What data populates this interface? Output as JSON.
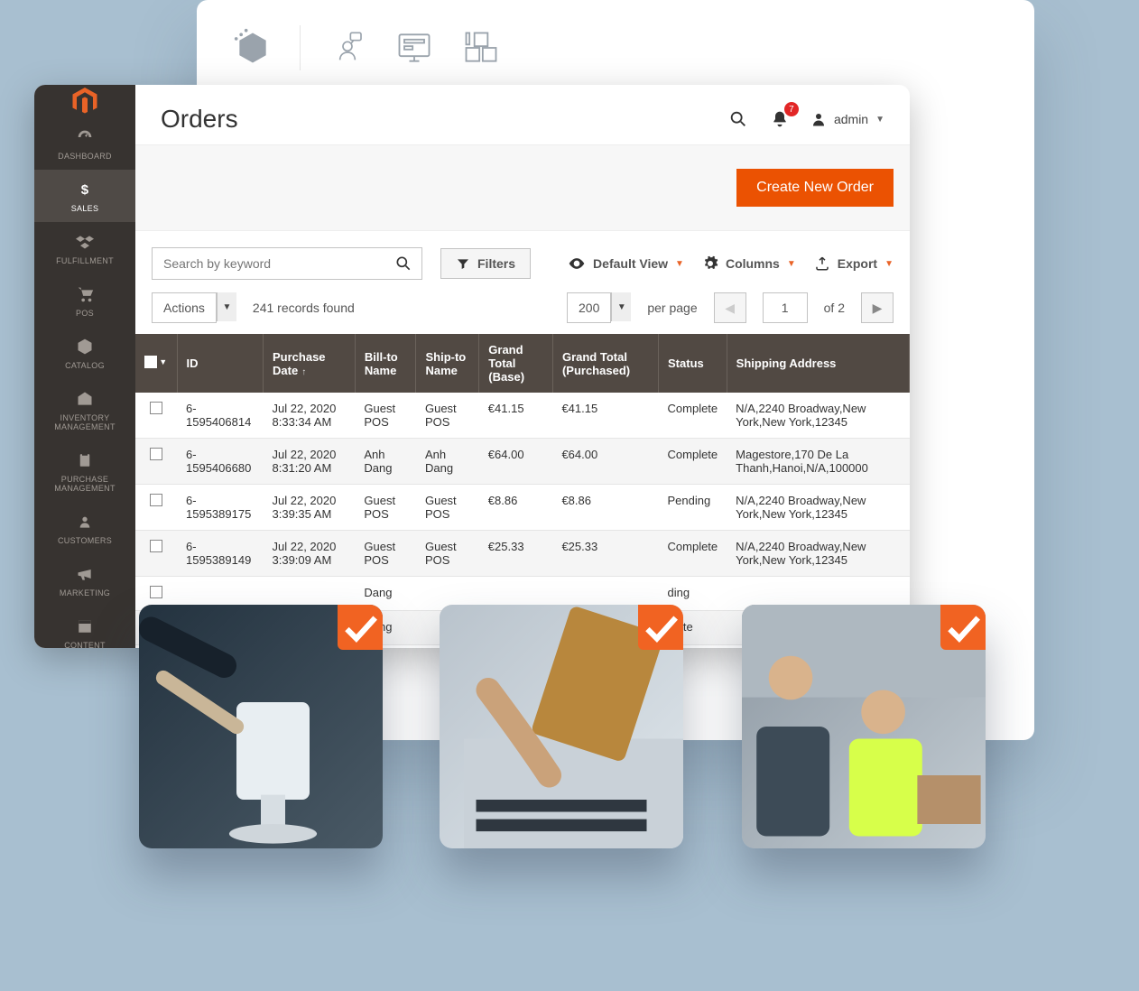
{
  "header": {
    "page_title": "Orders",
    "notification_count": "7",
    "user_label": "admin",
    "create_button": "Create New Order"
  },
  "sidebar": {
    "items": [
      {
        "label": "DASHBOARD"
      },
      {
        "label": "SALES"
      },
      {
        "label": "FULFILLMENT"
      },
      {
        "label": "POS"
      },
      {
        "label": "CATALOG"
      },
      {
        "label": "INVENTORY MANAGEMENT"
      },
      {
        "label": "PURCHASE MANAGEMENT"
      },
      {
        "label": "CUSTOMERS"
      },
      {
        "label": "MARKETING"
      },
      {
        "label": "CONTENT"
      }
    ]
  },
  "toolbar": {
    "search_placeholder": "Search by keyword",
    "filters_label": "Filters",
    "default_view_label": "Default View",
    "columns_label": "Columns",
    "export_label": "Export",
    "actions_label": "Actions",
    "records_found": "241 records found",
    "page_size": "200",
    "per_page_label": "per page",
    "current_page": "1",
    "page_of": "of 2"
  },
  "table": {
    "columns": [
      "ID",
      "Purchase Date",
      "Bill-to Name",
      "Ship-to Name",
      "Grand Total (Base)",
      "Grand Total (Purchased)",
      "Status",
      "Shipping Address"
    ],
    "rows": [
      {
        "id": "6-1595406814",
        "date": "Jul 22, 2020 8:33:34 AM",
        "bill": "Guest POS",
        "ship": "Guest POS",
        "gt_base": "€41.15",
        "gt_pur": "€41.15",
        "status": "Complete",
        "addr": "N/A,2240 Broadway,New York,New York,12345"
      },
      {
        "id": "6-1595406680",
        "date": "Jul 22, 2020 8:31:20 AM",
        "bill": "Anh Dang",
        "ship": "Anh Dang",
        "gt_base": "€64.00",
        "gt_pur": "€64.00",
        "status": "Complete",
        "addr": "Magestore,170 De La Thanh,Hanoi,N/A,100000"
      },
      {
        "id": "6-1595389175",
        "date": "Jul 22, 2020 3:39:35 AM",
        "bill": "Guest POS",
        "ship": "Guest POS",
        "gt_base": "€8.86",
        "gt_pur": "€8.86",
        "status": "Pending",
        "addr": "N/A,2240 Broadway,New York,New York,12345"
      },
      {
        "id": "6-1595389149",
        "date": "Jul 22, 2020 3:39:09 AM",
        "bill": "Guest POS",
        "ship": "Guest POS",
        "gt_base": "€25.33",
        "gt_pur": "€25.33",
        "status": "Complete",
        "addr": "N/A,2240 Broadway,New York,New York,12345"
      },
      {
        "id": "",
        "date": "",
        "bill": "Dang",
        "ship": "",
        "gt_base": "",
        "gt_pur": "",
        "status": "ding",
        "addr": ""
      },
      {
        "id": "",
        "date": "",
        "bill": "Dang",
        "ship": "",
        "gt_base": "",
        "gt_pur": "",
        "status": "plete",
        "addr": ""
      }
    ]
  }
}
